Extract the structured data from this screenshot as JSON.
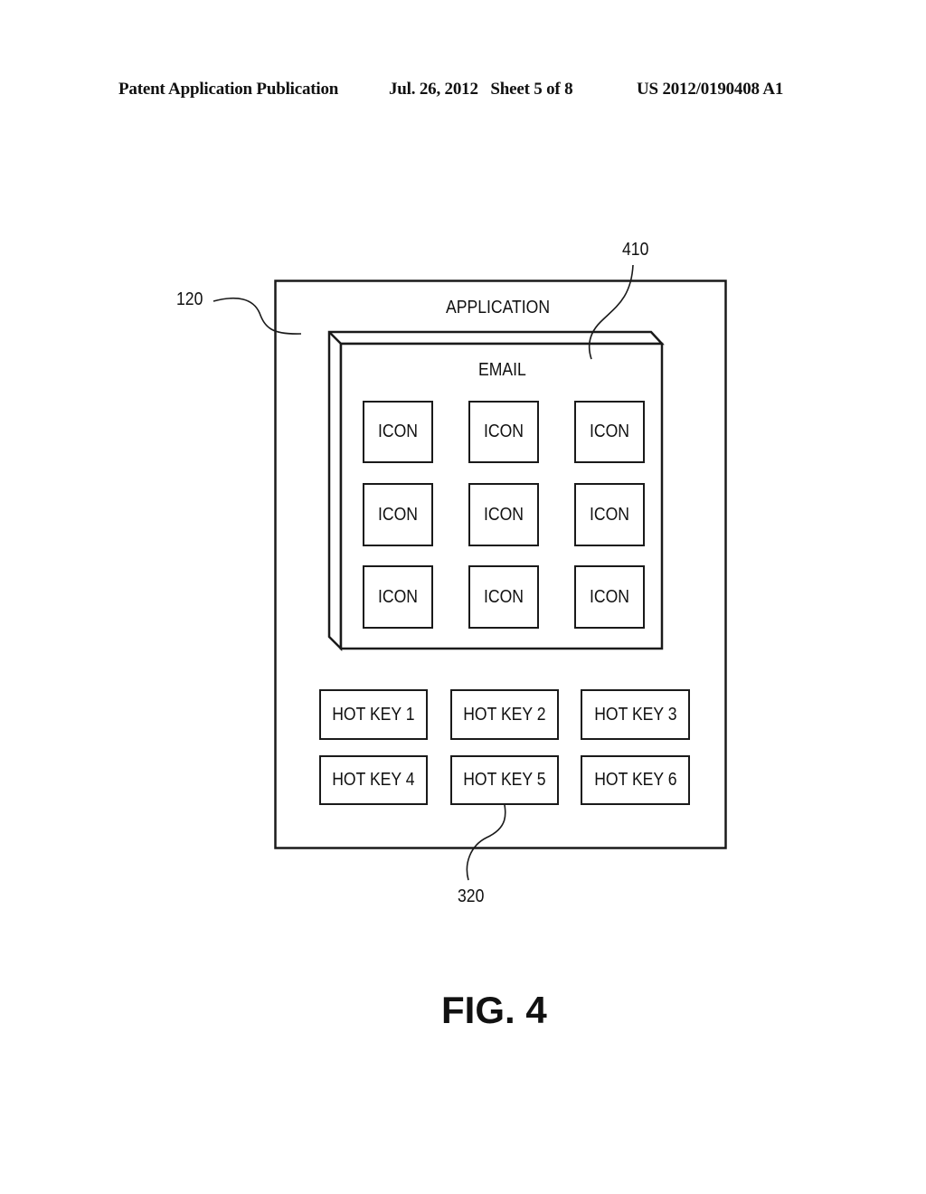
{
  "header": {
    "publication": "Patent Application Publication",
    "date_sheet": "Jul. 26, 2012   Sheet 5 of 8",
    "number": "US 2012/0190408 A1"
  },
  "figure": {
    "caption": "FIG. 4",
    "references": {
      "device": "120",
      "email_window": "410",
      "hot_keys": "320"
    },
    "application_label": "APPLICATION",
    "email_label": "EMAIL",
    "icons": [
      "ICON",
      "ICON",
      "ICON",
      "ICON",
      "ICON",
      "ICON",
      "ICON",
      "ICON",
      "ICON"
    ],
    "hot_keys": [
      "HOT KEY 1",
      "HOT KEY 2",
      "HOT KEY 3",
      "HOT KEY 4",
      "HOT KEY 5",
      "HOT KEY 6"
    ]
  }
}
